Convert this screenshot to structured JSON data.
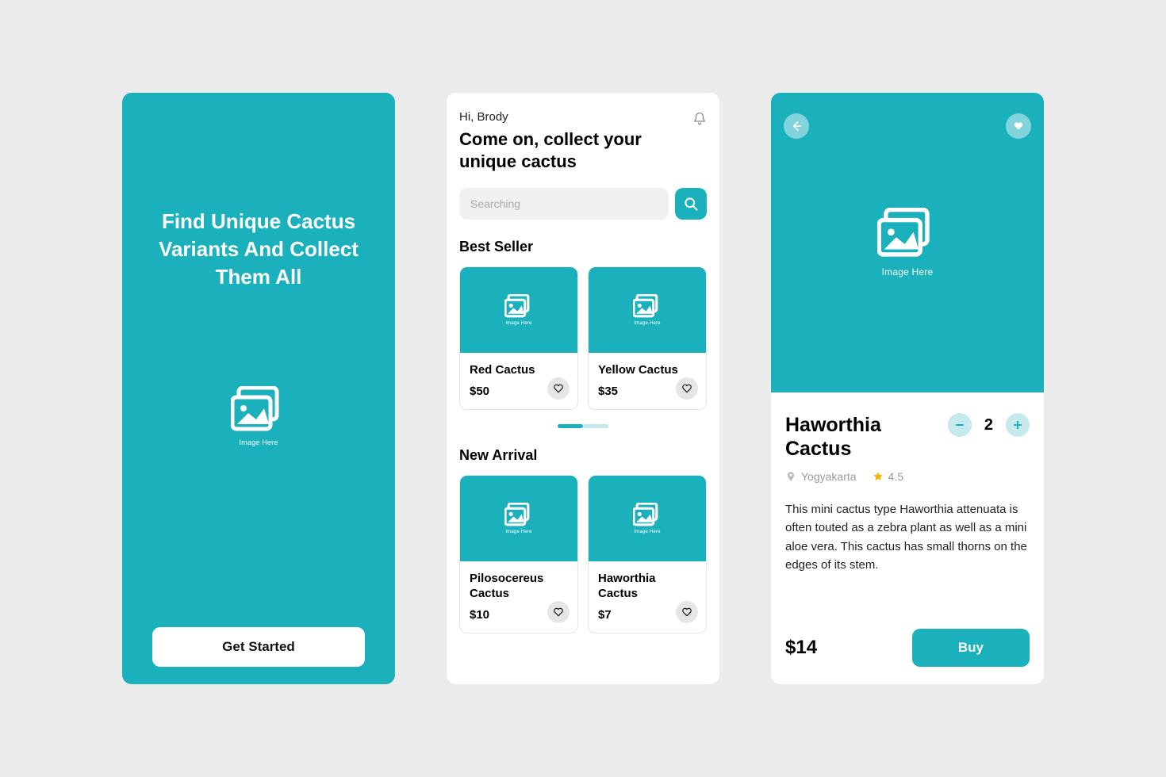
{
  "colors": {
    "accent": "#1ab1bd"
  },
  "image_placeholder_label": "Image Here",
  "onboarding": {
    "title": "Find Unique Cactus Variants And Collect Them All",
    "cta": "Get Started"
  },
  "home": {
    "greeting": "Hi, Brody",
    "headline": "Come on, collect your unique cactus",
    "search_placeholder": "Searching",
    "best_seller_title": "Best Seller",
    "new_arrival_title": "New Arrival",
    "best_seller": [
      {
        "name": "Red Cactus",
        "price": "$50"
      },
      {
        "name": "Yellow Cactus",
        "price": "$35"
      }
    ],
    "new_arrival": [
      {
        "name": "Pilosocereus Cactus",
        "price": "$10"
      },
      {
        "name": "Haworthia Cactus",
        "price": "$7"
      }
    ]
  },
  "detail": {
    "title": "Haworthia Cactus",
    "quantity": "2",
    "location": "Yogyakarta",
    "rating": "4.5",
    "description": "This mini cactus type Haworthia attenuata is often touted as a zebra plant as well as a mini aloe vera. This cactus has small thorns on the edges of its stem.",
    "price": "$14",
    "buy_label": "Buy"
  }
}
